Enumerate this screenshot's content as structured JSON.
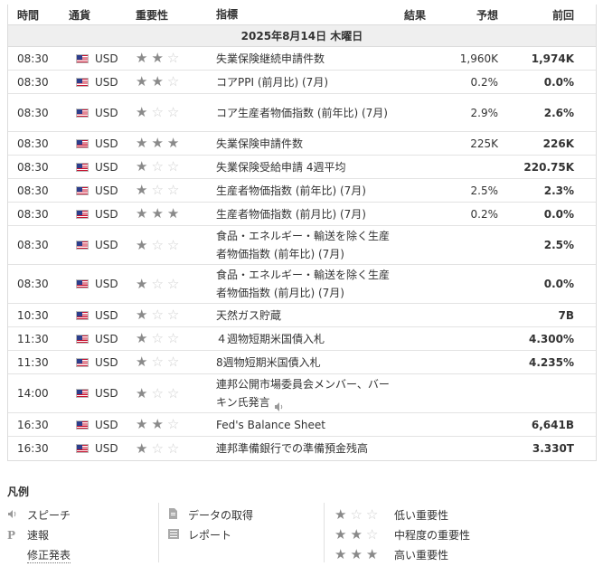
{
  "header": {
    "time": "時間",
    "currency": "通貨",
    "importance": "重要性",
    "event": "指標",
    "actual": "結果",
    "forecast": "予想",
    "previous": "前回"
  },
  "date": "2025年8月14日 木曜日",
  "rows": [
    {
      "time": "08:30",
      "currency": "USD",
      "stars": 2,
      "event": "失業保険継続申請件数",
      "actual": "",
      "forecast": "1,960K",
      "previous": "1,974K"
    },
    {
      "time": "08:30",
      "currency": "USD",
      "stars": 2,
      "event": "コアPPI (前月比) (7月)",
      "actual": "",
      "forecast": "0.2%",
      "previous": "0.0%"
    },
    {
      "time": "08:30",
      "currency": "USD",
      "stars": 1,
      "event": "コア生産者物価指数 (前年比) (7月)",
      "actual": "",
      "forecast": "2.9%",
      "previous": "2.6%"
    },
    {
      "time": "08:30",
      "currency": "USD",
      "stars": 3,
      "event": "失業保険申請件数",
      "actual": "",
      "forecast": "225K",
      "previous": "226K"
    },
    {
      "time": "08:30",
      "currency": "USD",
      "stars": 1,
      "event": "失業保険受給申請 4週平均",
      "actual": "",
      "forecast": "",
      "previous": "220.75K"
    },
    {
      "time": "08:30",
      "currency": "USD",
      "stars": 1,
      "event": "生産者物価指数 (前年比) (7月)",
      "actual": "",
      "forecast": "2.5%",
      "previous": "2.3%"
    },
    {
      "time": "08:30",
      "currency": "USD",
      "stars": 3,
      "event": "生産者物価指数 (前月比) (7月)",
      "actual": "",
      "forecast": "0.2%",
      "previous": "0.0%"
    },
    {
      "time": "08:30",
      "currency": "USD",
      "stars": 1,
      "event": "食品・エネルギー・輸送を除く生産者物価指数 (前年比) (7月)",
      "actual": "",
      "forecast": "",
      "previous": "2.5%"
    },
    {
      "time": "08:30",
      "currency": "USD",
      "stars": 1,
      "event": "食品・エネルギー・輸送を除く生産者物価指数 (前月比) (7月)",
      "actual": "",
      "forecast": "",
      "previous": "0.0%"
    },
    {
      "time": "10:30",
      "currency": "USD",
      "stars": 1,
      "event": "天然ガス貯蔵",
      "actual": "",
      "forecast": "",
      "previous": "7B"
    },
    {
      "time": "11:30",
      "currency": "USD",
      "stars": 1,
      "event": "４週物短期米国債入札",
      "actual": "",
      "forecast": "",
      "previous": "4.300%"
    },
    {
      "time": "11:30",
      "currency": "USD",
      "stars": 1,
      "event": "8週物短期米国債入札",
      "actual": "",
      "forecast": "",
      "previous": "4.235%"
    },
    {
      "time": "14:00",
      "currency": "USD",
      "stars": 1,
      "event": "連邦公開市場委員会メンバー、バーキン氏発言",
      "actual": "",
      "forecast": "",
      "previous": "",
      "speech": true
    },
    {
      "time": "16:30",
      "currency": "USD",
      "stars": 2,
      "event": "Fed's Balance Sheet",
      "actual": "",
      "forecast": "",
      "previous": "6,641B"
    },
    {
      "time": "16:30",
      "currency": "USD",
      "stars": 1,
      "event": "連邦準備銀行での準備預金残高",
      "actual": "",
      "forecast": "",
      "previous": "3.330T"
    }
  ],
  "legend": {
    "title": "凡例",
    "speech": "スピーチ",
    "preliminary_icon": "P",
    "preliminary": "速報",
    "revised": "修正発表",
    "data_retrieval": "データの取得",
    "report": "レポート",
    "low": "低い重要性",
    "medium": "中程度の重要性",
    "high": "高い重要性"
  },
  "colors": {
    "star_on": "#8a8a8a",
    "star_off": "#cfcfcf",
    "date_bg": "#efefef"
  }
}
